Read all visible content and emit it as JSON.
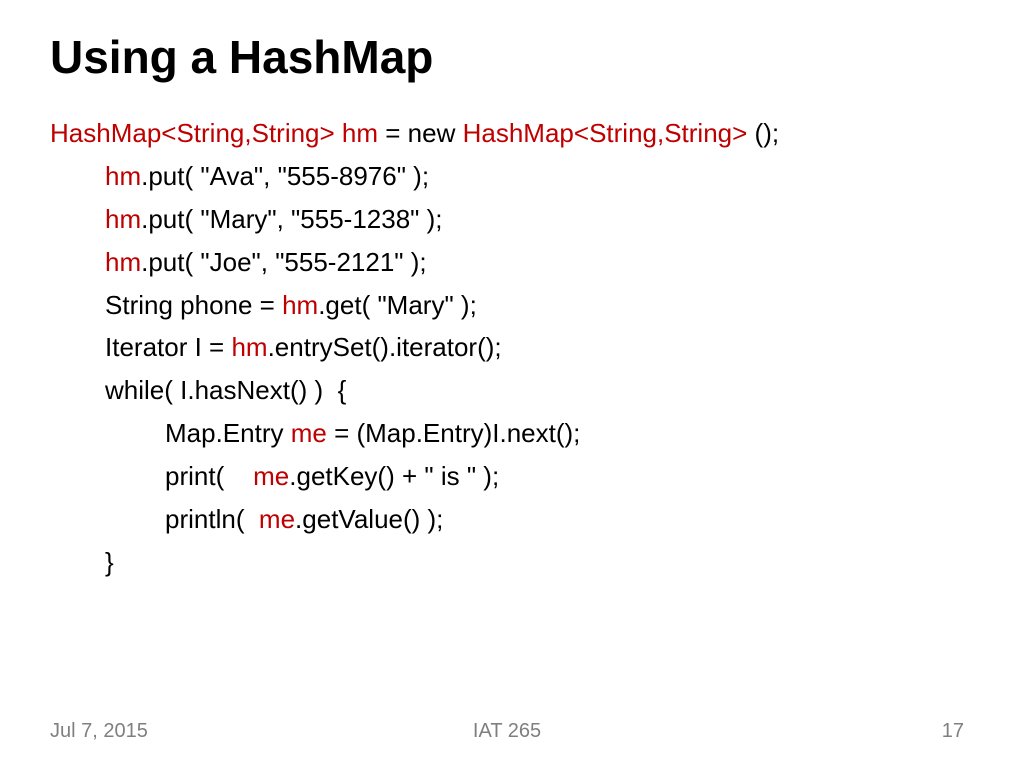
{
  "slide": {
    "title": "Using a HashMap",
    "code": {
      "l1_p1": "HashMap<String,String> hm",
      "l1_p2": " = new ",
      "l1_p3": "HashMap<String,String>",
      "l1_p4": " ();",
      "l2_p1": "hm",
      "l2_p2": ".put( \"Ava\", \"555-8976\" );",
      "l3_p1": "hm",
      "l3_p2": ".put( \"Mary\", \"555-1238\" );",
      "l4_p1": "hm",
      "l4_p2": ".put( \"Joe\", \"555-2121\" );",
      "l5_p1": "String phone = ",
      "l5_p2": "hm",
      "l5_p3": ".get( \"Mary\" );",
      "l6_p1": "Iterator I = ",
      "l6_p2": "hm",
      "l6_p3": ".entrySet().iterator();",
      "l7": "while( I.hasNext() )  {",
      "l8_p1": "Map.Entry ",
      "l8_p2": "me",
      "l8_p3": " = (Map.Entry)I.next();",
      "l9_p1": "print(    ",
      "l9_p2": "me",
      "l9_p3": ".getKey() + \" is \" );",
      "l10_p1": "println(  ",
      "l10_p2": "me",
      "l10_p3": ".getValue() );",
      "l11": "}"
    }
  },
  "footer": {
    "date": "Jul 7, 2015",
    "course": "IAT 265",
    "page": "17"
  }
}
